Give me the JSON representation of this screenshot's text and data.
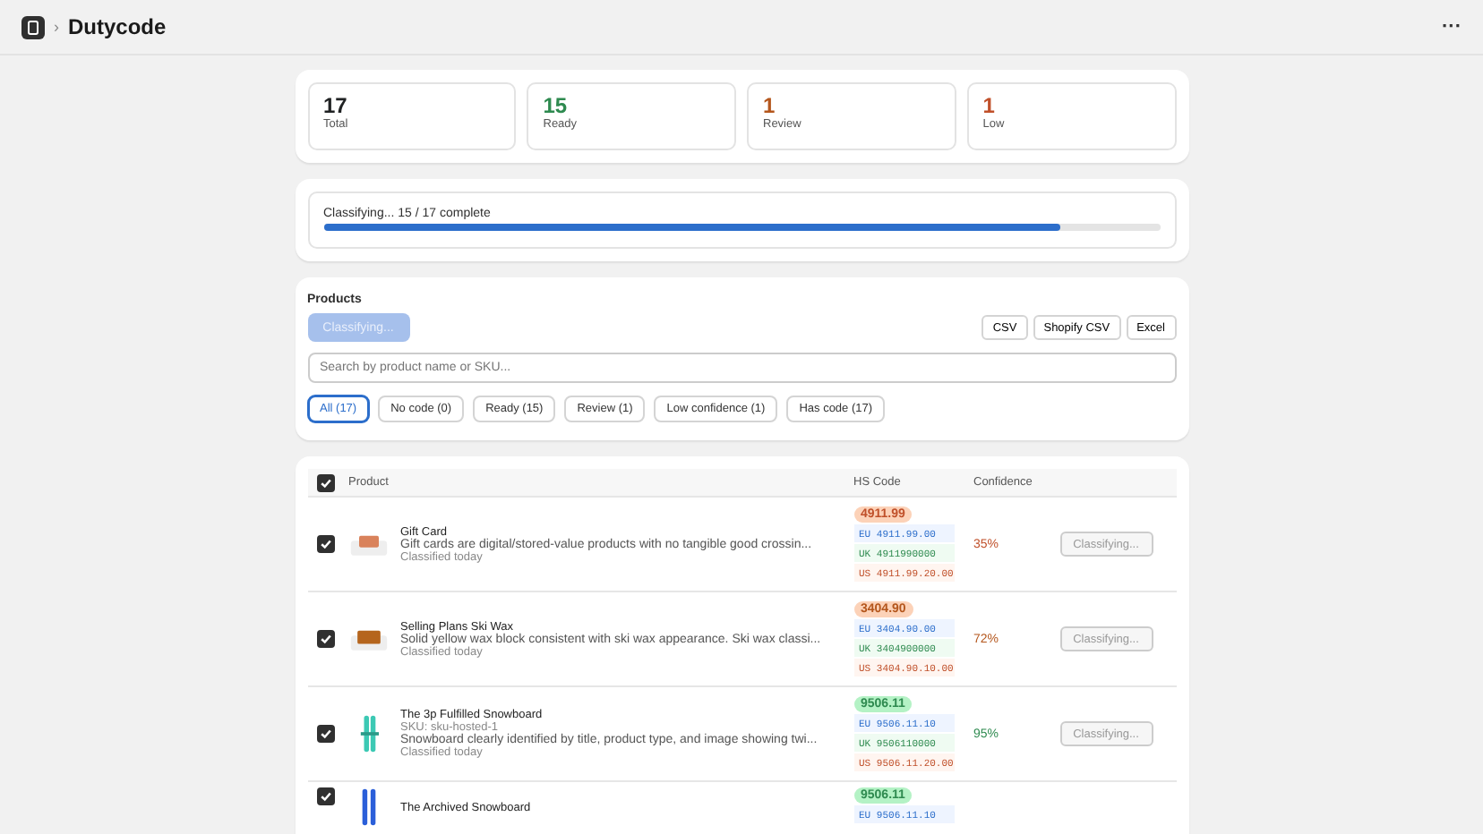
{
  "app_bar": {
    "title": "Dutycode",
    "breadcrumb_separator": "›",
    "menu": "···"
  },
  "stats": [
    {
      "value": "17",
      "label": "Total",
      "kind": "neutral"
    },
    {
      "value": "15",
      "label": "Ready",
      "kind": "ready"
    },
    {
      "value": "1",
      "label": "Review",
      "kind": "review"
    },
    {
      "value": "1",
      "label": "Low",
      "kind": "low"
    }
  ],
  "progress": {
    "text": "Classifying... 15 / 17 complete",
    "level": 0.882
  },
  "products": {
    "title": "Products",
    "classify_button": {
      "label": "Classifying...",
      "disabled": true
    },
    "exports": [
      "CSV",
      "Shopify CSV",
      "Excel"
    ],
    "search": {
      "placeholder": "Search by product name or SKU..."
    },
    "filters": [
      {
        "label": "All (17)",
        "selected": true
      },
      {
        "label": "No code (0)",
        "selected": false
      },
      {
        "label": "Ready (15)",
        "selected": false
      },
      {
        "label": "Review (1)",
        "selected": false
      },
      {
        "label": "Low confidence (1)",
        "selected": false
      },
      {
        "label": "Has code (17)",
        "selected": false
      }
    ]
  },
  "table": {
    "select_all_checked": true,
    "columns": [
      "Product",
      "HS Code",
      "Confidence"
    ],
    "rows": [
      {
        "checked": true,
        "kind": "card",
        "name": "Gift Card",
        "description": "Gift cards are digital/stored-value products with no tangible good crossin...",
        "classified": "Classified today",
        "color": "#c0502a",
        "hs_code": "4911.99",
        "codes": [
          {
            "region": "EU",
            "code": "4911.99.00",
            "color": "#2c6ecb"
          },
          {
            "region": "UK",
            "code": "4911990000",
            "color": "#2e8a4f"
          },
          {
            "region": "US",
            "code": "4911.99.20.00",
            "color": "#c0502a"
          }
        ],
        "confidence": "35%",
        "action": {
          "label": "Classifying...",
          "disabled": true
        }
      },
      {
        "checked": true,
        "kind": "block",
        "name": "Selling Plans Ski Wax",
        "description": "Solid yellow wax block consistent with ski wax appearance. Ski wax classi...",
        "classified": "Classified today",
        "color": "#b4561c",
        "hs_code": "3404.90",
        "codes": [
          {
            "region": "EU",
            "code": "3404.90.00",
            "color": "#2c6ecb"
          },
          {
            "region": "UK",
            "code": "3404900000",
            "color": "#2e8a4f"
          },
          {
            "region": "US",
            "code": "3404.90.10.00",
            "color": "#c0502a"
          }
        ],
        "confidence": "72%",
        "action": {
          "label": "Classifying...",
          "disabled": true
        }
      },
      {
        "checked": true,
        "kind": "board",
        "name": "The 3p Fulfilled Snowboard",
        "sku": "SKU: sku-hosted-1",
        "description": "Snowboard clearly identified by title, product type, and image showing twi...",
        "classified": "Classified today",
        "color": "#2e8a4f",
        "hs_code": "9506.11",
        "codes": [
          {
            "region": "EU",
            "code": "9506.11.10",
            "color": "#2c6ecb"
          },
          {
            "region": "UK",
            "code": "9506110000",
            "color": "#2e8a4f"
          },
          {
            "region": "US",
            "code": "9506.11.20.00",
            "color": "#c0502a"
          }
        ],
        "confidence": "95%",
        "action": {
          "label": "Classifying...",
          "disabled": true
        }
      },
      {
        "checked": true,
        "kind": "board2",
        "name": "The Archived Snowboard",
        "color": "#2e8a4f",
        "hs_code": "9506.11",
        "codes": [
          {
            "region": "EU",
            "code": "9506.11.10",
            "color": "#2c6ecb"
          }
        ]
      }
    ]
  }
}
